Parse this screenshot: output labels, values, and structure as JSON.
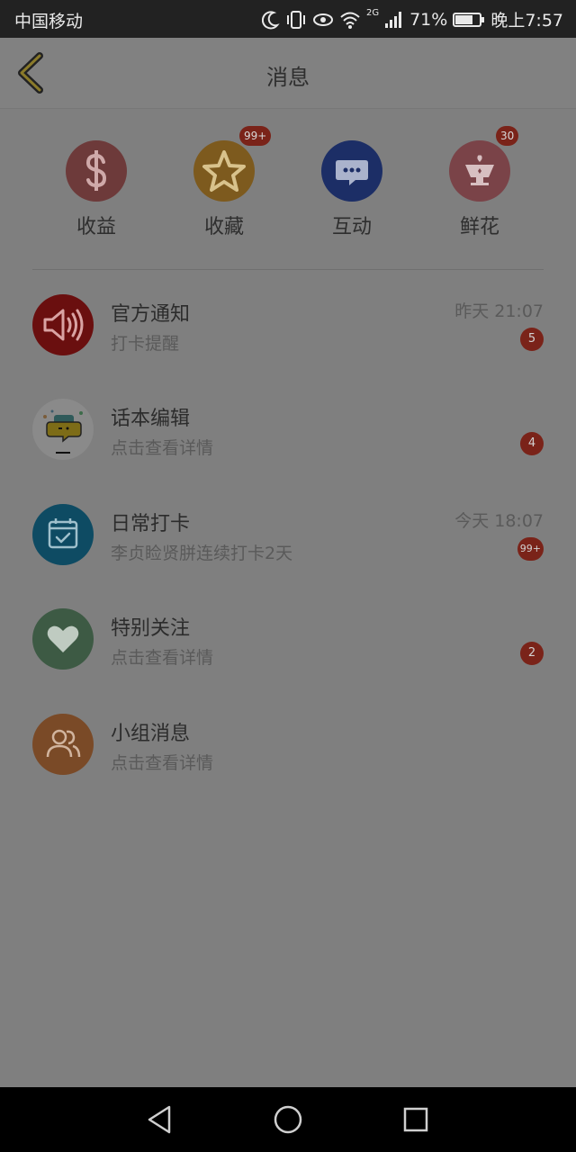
{
  "status_bar": {
    "carrier": "中国移动",
    "network": "2G",
    "battery": "71%",
    "time": "晚上7:57"
  },
  "header": {
    "title": "消息"
  },
  "quick_actions": [
    {
      "label": "收益",
      "badge": "",
      "color": "#6d3a3a",
      "icon": "dollar-icon"
    },
    {
      "label": "收藏",
      "badge": "99+",
      "color": "#7d5a1e",
      "icon": "star-icon"
    },
    {
      "label": "互动",
      "badge": "",
      "color": "#1c2e66",
      "icon": "chat-bubble-icon"
    },
    {
      "label": "鲜花",
      "badge": "30",
      "color": "#7a4348",
      "icon": "flower-bowl-icon"
    }
  ],
  "messages": [
    {
      "title": "官方通知",
      "subtitle": "打卡提醒",
      "time": "昨天 21:07",
      "badge": "5",
      "color": "#6a0f0f",
      "icon": "speaker-icon"
    },
    {
      "title": "话本编辑",
      "subtitle": "点击查看详情",
      "time": "",
      "badge": "4",
      "color": "#8a8a8a",
      "icon": "editor-chat-icon"
    },
    {
      "title": "日常打卡",
      "subtitle": "李贞睑贤胼连续打卡2天",
      "time": "今天 18:07",
      "badge": "99+",
      "color": "#0e4b63",
      "icon": "calendar-check-icon"
    },
    {
      "title": "特别关注",
      "subtitle": "点击查看详情",
      "time": "",
      "badge": "2",
      "color": "#3d5a44",
      "icon": "heart-icon"
    },
    {
      "title": "小组消息",
      "subtitle": "点击查看详情",
      "time": "",
      "badge": "",
      "color": "#7a4a27",
      "icon": "group-icon"
    }
  ]
}
